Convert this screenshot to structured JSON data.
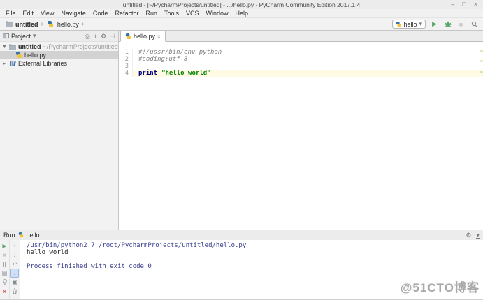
{
  "window": {
    "title": "untitled - [~/PycharmProjects/untitled] - .../hello.py - PyCharm Community Edition 2017.1.4",
    "minimize": "–",
    "maximize": "□",
    "close": "×"
  },
  "menubar": [
    "File",
    "Edit",
    "View",
    "Navigate",
    "Code",
    "Refactor",
    "Run",
    "Tools",
    "VCS",
    "Window",
    "Help"
  ],
  "breadcrumb": {
    "project": "untitled",
    "file": "hello.py",
    "sep": "›"
  },
  "toolbar": {
    "run_config": "hello"
  },
  "project_panel": {
    "title": "Project",
    "root_name": "untitled",
    "root_path": "~/PycharmProjects/untitled",
    "file": "hello.py",
    "external_libs": "External Libraries"
  },
  "editor": {
    "tab": "hello.py",
    "tab_close": "×",
    "line_numbers": [
      "1",
      "2",
      "3",
      "4"
    ],
    "comment1": "#!/ussr/bin/env python",
    "comment2": "#coding:utf-8",
    "blank": "",
    "keyword": "print",
    "string": "\"hello world\""
  },
  "run_panel": {
    "title": "Run",
    "config": "hello",
    "console": [
      "/usr/bin/python2.7 /root/PycharmProjects/untitled/hello.py",
      "hello world",
      "",
      "Process finished with exit code 0"
    ]
  },
  "watermark": "@51CTO博客",
  "icons": {
    "chevron_down": "▾",
    "tree_expanded": "▼",
    "tree_collapsed": "▸",
    "play": "▶",
    "stop": "■",
    "gear": "⚙",
    "target": "◎",
    "plus": "+",
    "hide": "⊣",
    "up": "↑",
    "down": "↓",
    "softwrap": "↩",
    "console_grid": "▤",
    "monitor": "▣",
    "close": "×"
  },
  "colors": {
    "keyword": "#000080",
    "string": "#008000",
    "comment": "#808080",
    "current_line": "#fffae3",
    "console_system": "#3b3f8f",
    "run_green": "#59a869"
  }
}
